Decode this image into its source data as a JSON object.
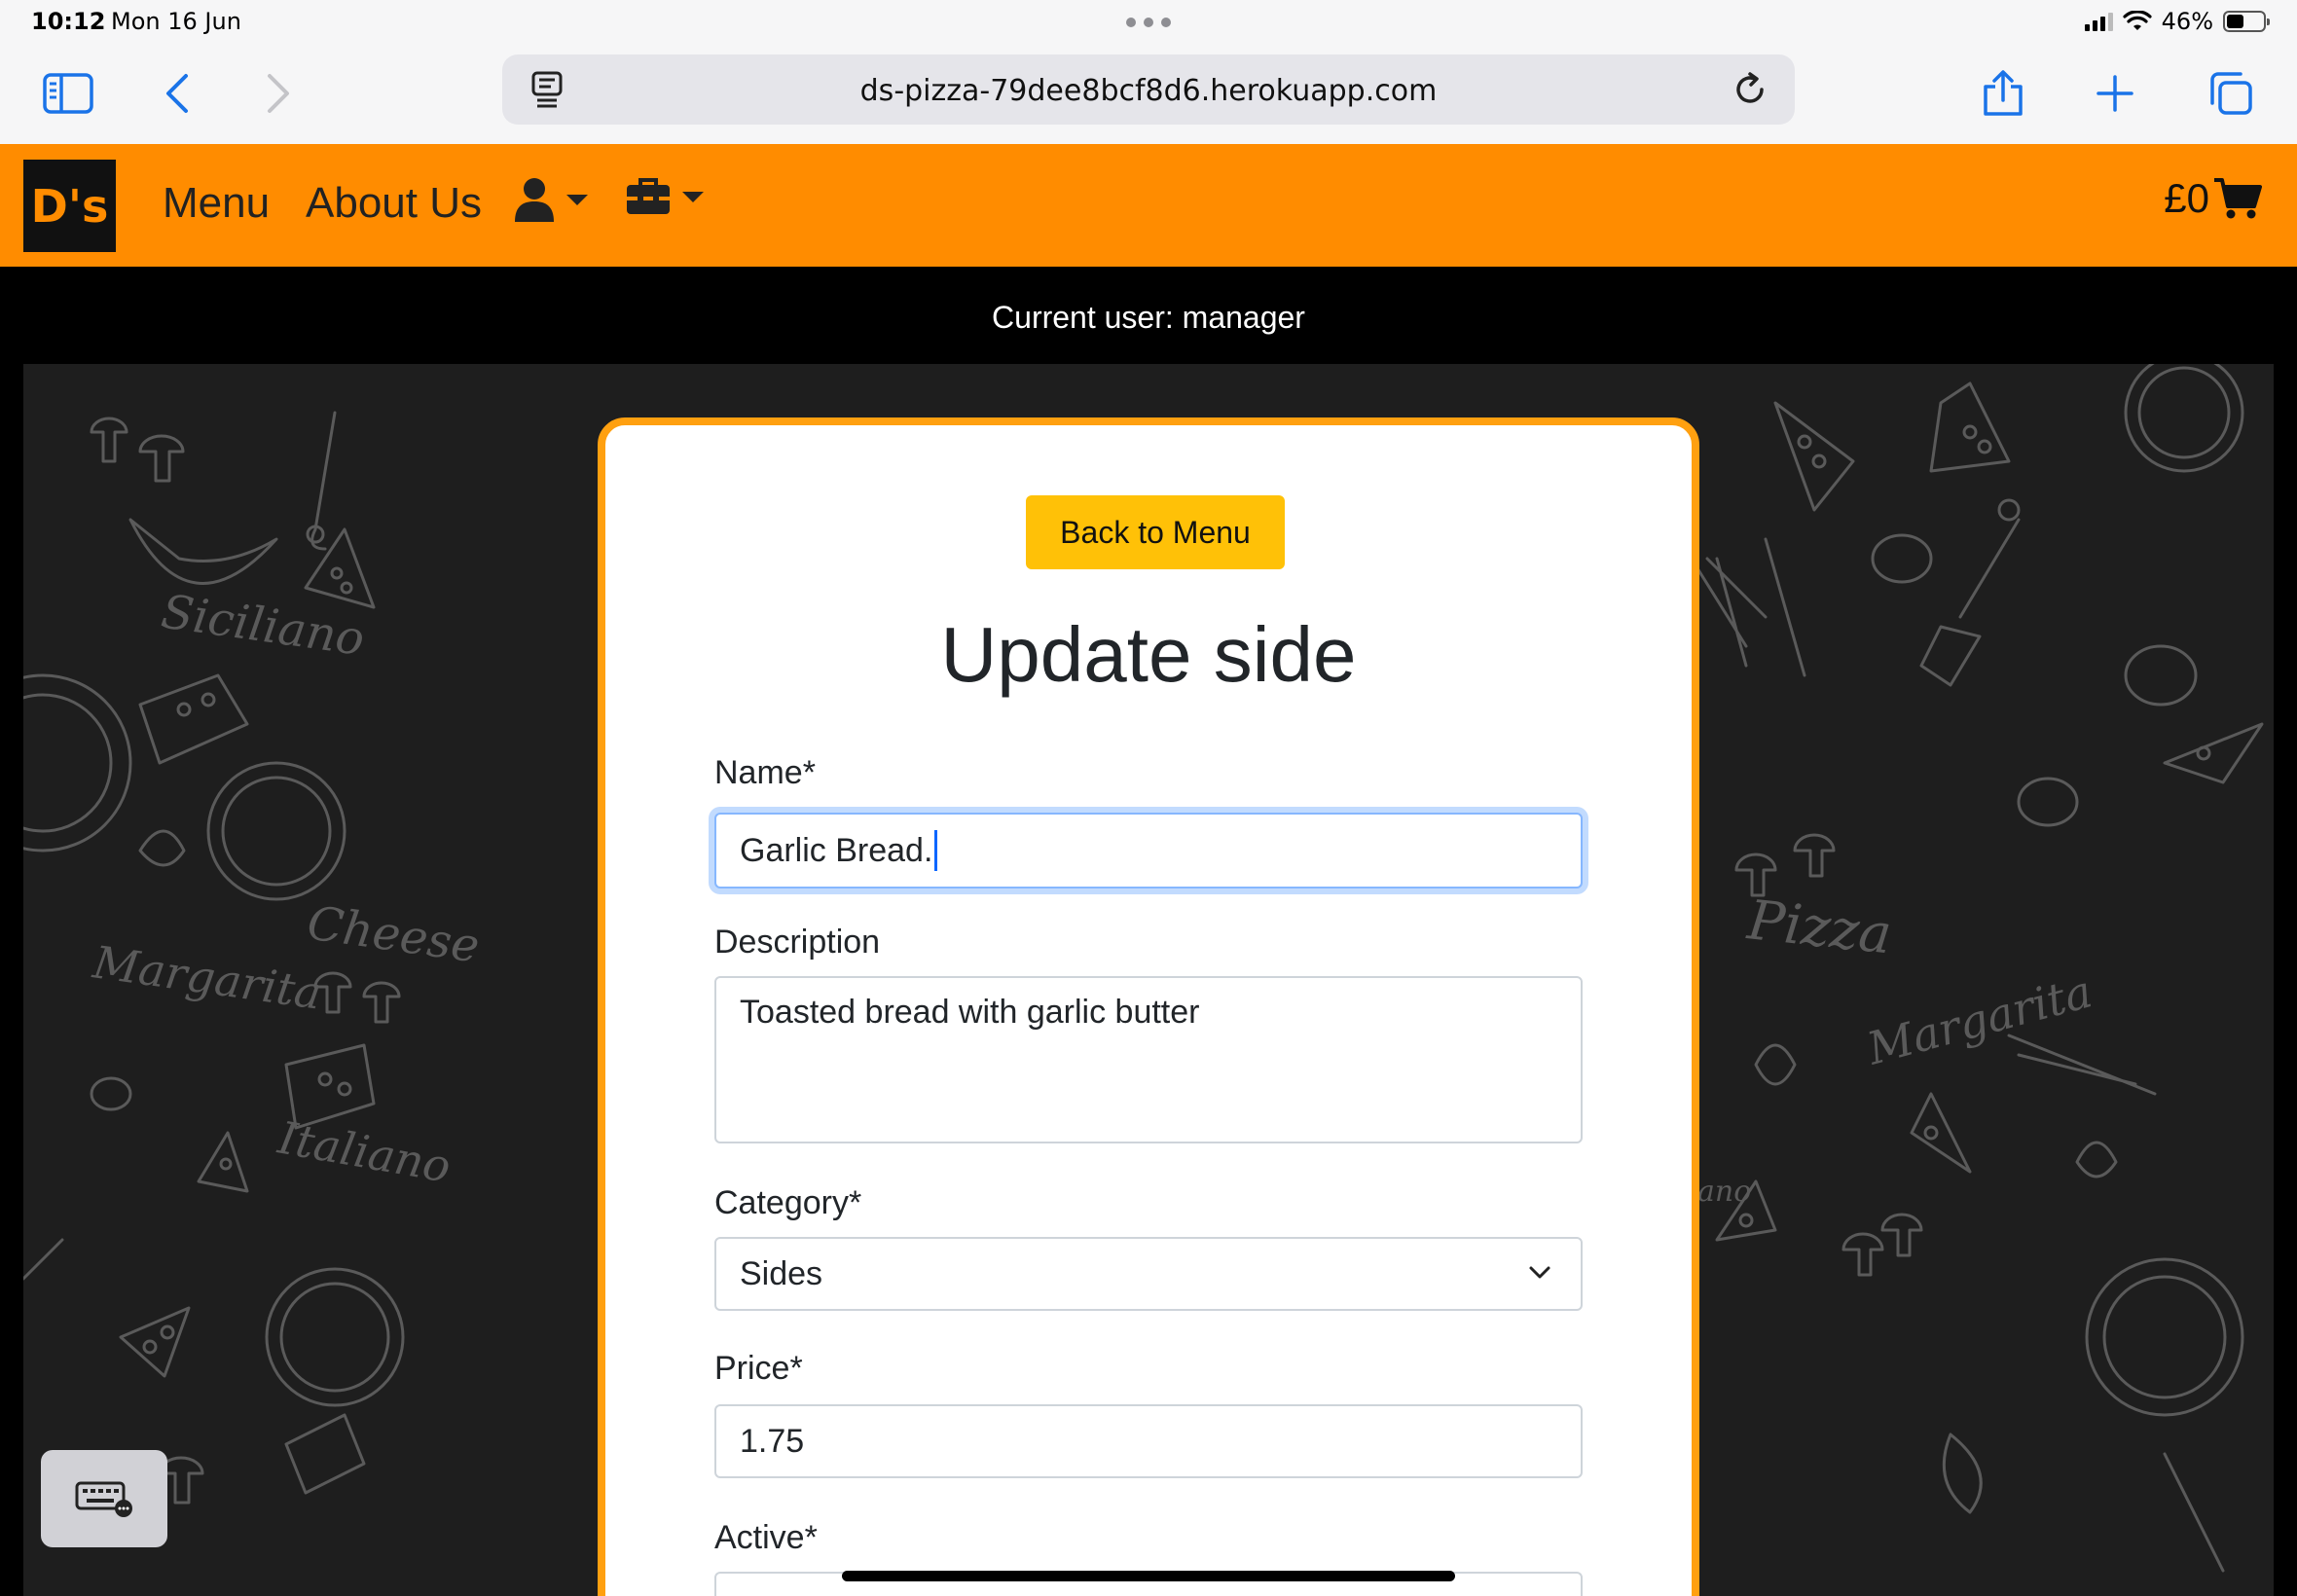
{
  "status": {
    "time": "10:12",
    "date": "Mon 16 Jun",
    "battery_text": "46%",
    "battery_level": 0.46
  },
  "browser": {
    "url": "ds-pizza-79dee8bcf8d6.herokuapp.com"
  },
  "nav": {
    "logo": "D's",
    "menu": "Menu",
    "about": "About Us",
    "cart_total": "£0",
    "brand_color": "#ff8c00"
  },
  "user_bar": {
    "text": "Current user: manager"
  },
  "form": {
    "back_button": "Back to Menu",
    "title": "Update side",
    "name_label": "Name*",
    "name_value": "Garlic Bread.",
    "description_label": "Description",
    "description_value": "Toasted bread with garlic butter",
    "category_label": "Category*",
    "category_value": "Sides",
    "price_label": "Price*",
    "price_value": "1.75",
    "active_label": "Active*"
  },
  "chalk_words": [
    "Siciliano",
    "Margarita",
    "Cheese",
    "Italiano",
    "Pizza",
    "Margarita",
    "ano"
  ],
  "icons": [
    "sidebar-icon",
    "back-chevron-icon",
    "forward-chevron-icon",
    "page-icon",
    "reload-icon",
    "share-icon",
    "new-tab-icon",
    "tabs-icon",
    "user-icon",
    "toolbox-icon",
    "cart-icon",
    "keyboard-icon",
    "select-chevron-icon"
  ]
}
